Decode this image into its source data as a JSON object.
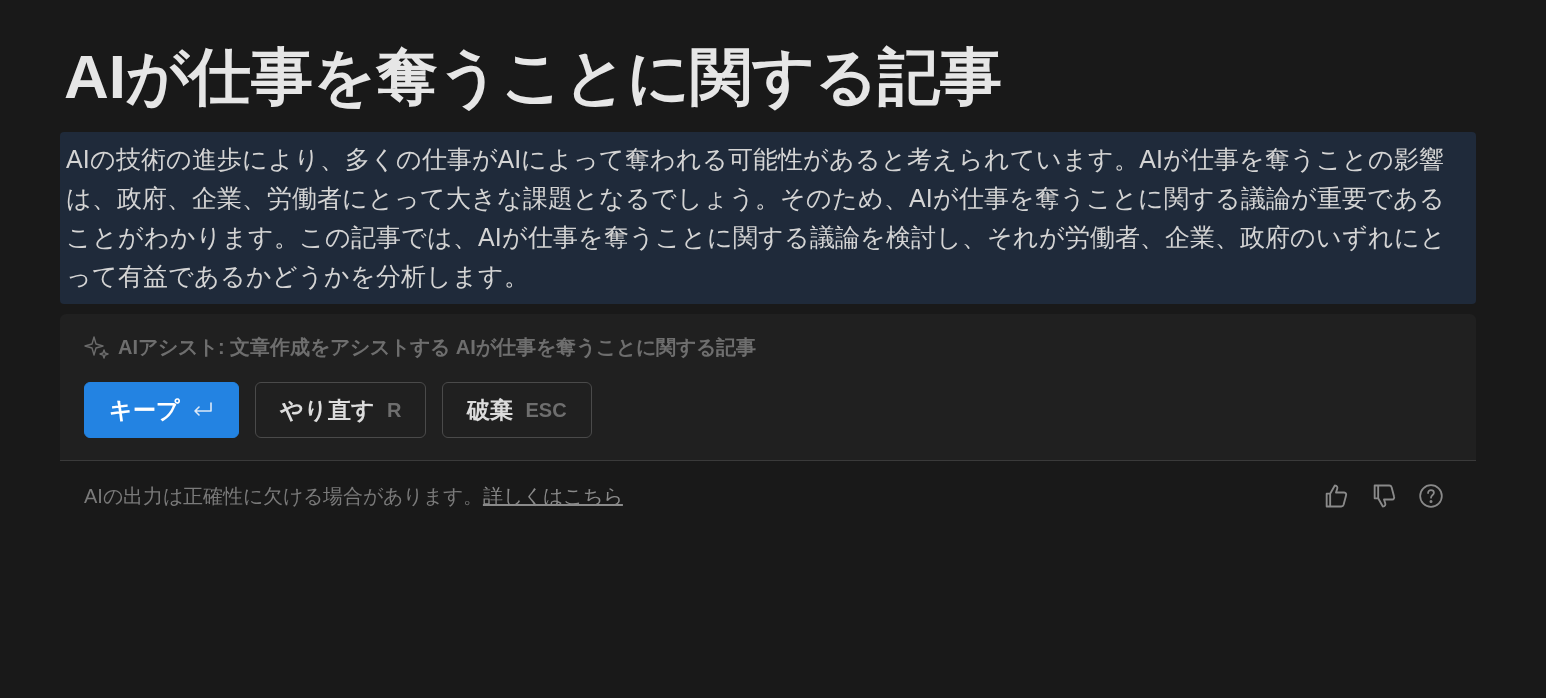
{
  "title": "AIが仕事を奪うことに関する記事",
  "paragraph": {
    "text": "AIの技術の進歩により、多くの仕事がAIによって奪われる可能性があると考えられています。AIが仕事を奪うことの影響は、政府、企業、労働者にとって大きな課題となるでしょう。そのため、AIが仕事を奪うことに関する議論が重要であることがわかります。この記事では、AIが仕事を奪うことに関する議論を検討し、それが労働者、企業、政府のいずれにとって有益であるかどうかを分析します。",
    "selected": true
  },
  "assist": {
    "label": "AIアシスト: 文章作成をアシストする AIが仕事を奪うことに関する記事"
  },
  "buttons": [
    {
      "label": "キープ",
      "kind": "primary"
    },
    {
      "label": "やり直す",
      "shortcut": "R",
      "kind": "outline"
    },
    {
      "label": "破棄",
      "shortcut": "ESC",
      "kind": "outline"
    }
  ],
  "footer": {
    "disclaimer": "AIの出力は正確性に欠ける場合があります。",
    "link": "詳しくはこちら"
  }
}
